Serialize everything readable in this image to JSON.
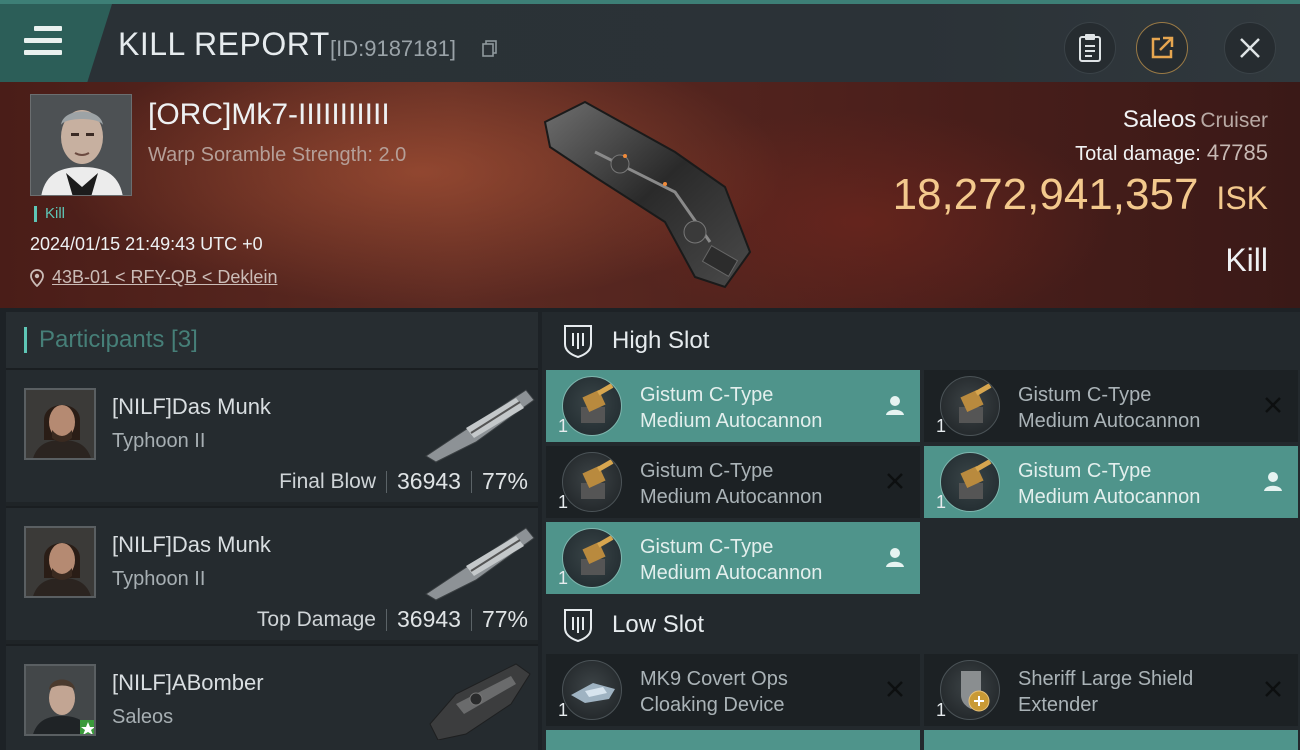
{
  "header": {
    "title": "KILL REPORT",
    "report_id": "[ID:9187181]",
    "icons": {
      "menu": "menu-icon",
      "copy": "copy-icon",
      "clipboard": "clipboard-icon",
      "share": "share-icon",
      "close": "close-icon"
    }
  },
  "victim": {
    "name": "[ORC]Mk7-IIIIIIIIIII",
    "scramble": "Warp Soramble Strength: 2.0",
    "kill_tag": "Kill",
    "time": "2024/01/15 21:49:43 UTC +0",
    "location": "43B-01 < RFY-QB < Deklein",
    "ship_name": "Saleos",
    "ship_class": "Cruiser",
    "damage_label": "Total damage:",
    "damage_value": "47785",
    "isk_value": "18,272,941,357",
    "isk_currency": "ISK",
    "result": "Kill"
  },
  "participants": {
    "label": "Participants [3]",
    "rows": [
      {
        "name": "[NILF]Das Munk",
        "ship": "Typhoon II",
        "role": "Final Blow",
        "damage": "36943",
        "percent": "77%"
      },
      {
        "name": "[NILF]Das Munk",
        "ship": "Typhoon II",
        "role": "Top Damage",
        "damage": "36943",
        "percent": "77%"
      },
      {
        "name": "[NILF]ABomber",
        "ship": "Saleos"
      }
    ]
  },
  "slots": {
    "high": {
      "label": "High Slot",
      "modules": [
        {
          "line1": "Gistum C-Type",
          "line2": "Medium Autocannon",
          "qty": "1",
          "state": "fitted"
        },
        {
          "line1": "Gistum C-Type",
          "line2": "Medium Autocannon",
          "qty": "1",
          "state": "destroyed"
        },
        {
          "line1": "Gistum C-Type",
          "line2": "Medium Autocannon",
          "qty": "1",
          "state": "destroyed"
        },
        {
          "line1": "Gistum C-Type",
          "line2": "Medium Autocannon",
          "qty": "1",
          "state": "fitted"
        },
        {
          "line1": "Gistum C-Type",
          "line2": "Medium Autocannon",
          "qty": "1",
          "state": "fitted"
        }
      ]
    },
    "low": {
      "label": "Low Slot",
      "modules": [
        {
          "line1": "MK9 Covert Ops",
          "line2": "Cloaking Device",
          "qty": "1",
          "state": "destroyed"
        },
        {
          "line1": "Sheriff Large Shield",
          "line2": "Extender",
          "qty": "1",
          "state": "destroyed"
        }
      ]
    }
  },
  "colors": {
    "accent": "#5ec6b6",
    "fitted": "#4f948b",
    "isk": "#f3c98d",
    "banner": "#5c2a22"
  }
}
